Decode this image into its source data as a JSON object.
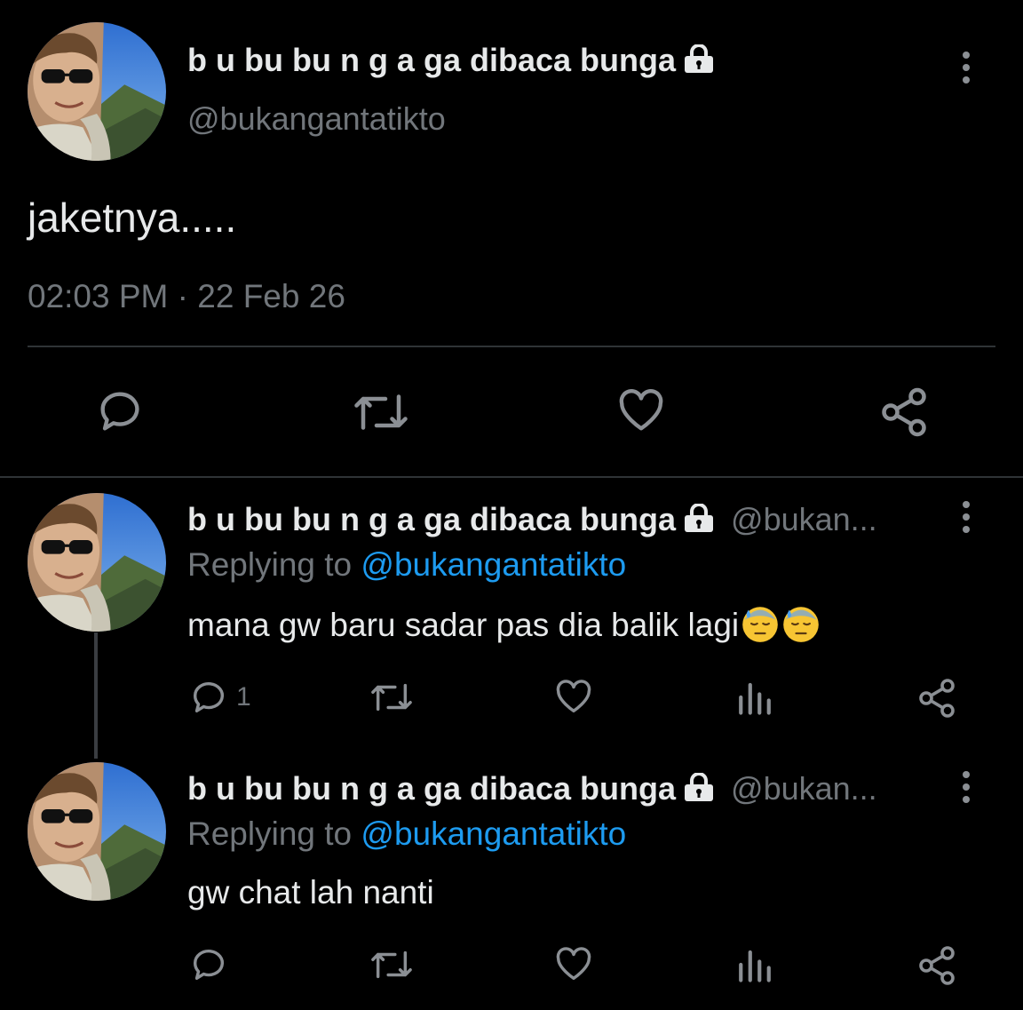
{
  "main_tweet": {
    "display_name": "b u bu bu n g a ga dibaca bunga",
    "handle": "@bukangantatikto",
    "text": "jaketnya.....",
    "time": "02:03 PM",
    "separator": "·",
    "date": "22 Feb 26"
  },
  "replies": [
    {
      "display_name": "b u bu bu n g a ga dibaca bunga",
      "handle_truncated": "@bukan...",
      "replying_prefix": "Replying to",
      "replying_handle": "@bukangantatikto",
      "text": "mana gw baru sadar pas dia balik lagi",
      "emojis": [
        "downcast-face-with-sweat",
        "downcast-face-with-sweat"
      ],
      "reply_count": "1"
    },
    {
      "display_name": "b u bu bu n g a ga dibaca bunga",
      "handle_truncated": "@bukan...",
      "replying_prefix": "Replying to",
      "replying_handle": "@bukangantatikto",
      "text": "gw chat lah nanti",
      "reply_count": ""
    }
  ],
  "icons": {
    "reply": "reply-icon",
    "retweet": "retweet-icon",
    "like": "heart-icon",
    "views": "views-icon",
    "share": "share-icon",
    "more": "kebab-menu-icon",
    "locked": "lock-icon"
  },
  "colors": {
    "background": "#000000",
    "text": "#e7e9ea",
    "muted": "#71767b",
    "link": "#1d9bf0",
    "divider": "#2f3336"
  }
}
